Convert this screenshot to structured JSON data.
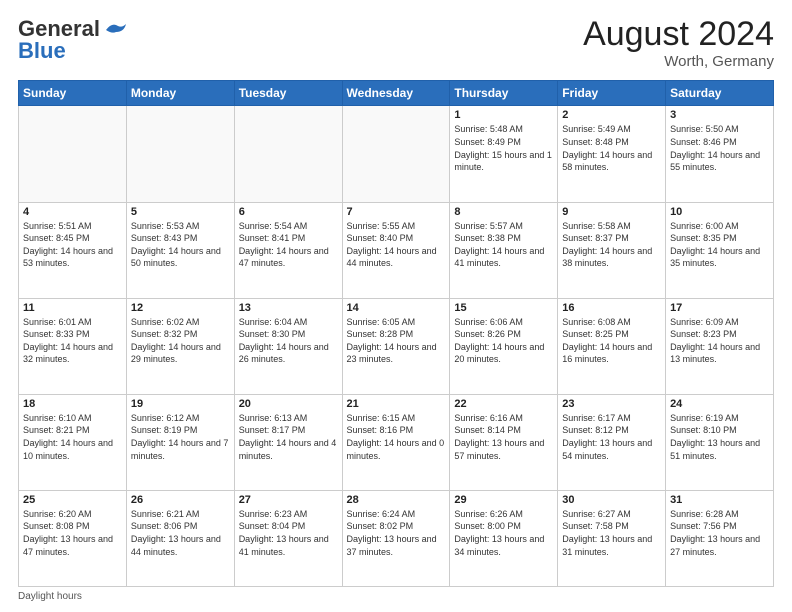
{
  "header": {
    "logo_general": "General",
    "logo_blue": "Blue",
    "month_year": "August 2024",
    "location": "Worth, Germany"
  },
  "days_of_week": [
    "Sunday",
    "Monday",
    "Tuesday",
    "Wednesday",
    "Thursday",
    "Friday",
    "Saturday"
  ],
  "weeks": [
    [
      {
        "day": "",
        "info": ""
      },
      {
        "day": "",
        "info": ""
      },
      {
        "day": "",
        "info": ""
      },
      {
        "day": "",
        "info": ""
      },
      {
        "day": "1",
        "info": "Sunrise: 5:48 AM\nSunset: 8:49 PM\nDaylight: 15 hours\nand 1 minute."
      },
      {
        "day": "2",
        "info": "Sunrise: 5:49 AM\nSunset: 8:48 PM\nDaylight: 14 hours\nand 58 minutes."
      },
      {
        "day": "3",
        "info": "Sunrise: 5:50 AM\nSunset: 8:46 PM\nDaylight: 14 hours\nand 55 minutes."
      }
    ],
    [
      {
        "day": "4",
        "info": "Sunrise: 5:51 AM\nSunset: 8:45 PM\nDaylight: 14 hours\nand 53 minutes."
      },
      {
        "day": "5",
        "info": "Sunrise: 5:53 AM\nSunset: 8:43 PM\nDaylight: 14 hours\nand 50 minutes."
      },
      {
        "day": "6",
        "info": "Sunrise: 5:54 AM\nSunset: 8:41 PM\nDaylight: 14 hours\nand 47 minutes."
      },
      {
        "day": "7",
        "info": "Sunrise: 5:55 AM\nSunset: 8:40 PM\nDaylight: 14 hours\nand 44 minutes."
      },
      {
        "day": "8",
        "info": "Sunrise: 5:57 AM\nSunset: 8:38 PM\nDaylight: 14 hours\nand 41 minutes."
      },
      {
        "day": "9",
        "info": "Sunrise: 5:58 AM\nSunset: 8:37 PM\nDaylight: 14 hours\nand 38 minutes."
      },
      {
        "day": "10",
        "info": "Sunrise: 6:00 AM\nSunset: 8:35 PM\nDaylight: 14 hours\nand 35 minutes."
      }
    ],
    [
      {
        "day": "11",
        "info": "Sunrise: 6:01 AM\nSunset: 8:33 PM\nDaylight: 14 hours\nand 32 minutes."
      },
      {
        "day": "12",
        "info": "Sunrise: 6:02 AM\nSunset: 8:32 PM\nDaylight: 14 hours\nand 29 minutes."
      },
      {
        "day": "13",
        "info": "Sunrise: 6:04 AM\nSunset: 8:30 PM\nDaylight: 14 hours\nand 26 minutes."
      },
      {
        "day": "14",
        "info": "Sunrise: 6:05 AM\nSunset: 8:28 PM\nDaylight: 14 hours\nand 23 minutes."
      },
      {
        "day": "15",
        "info": "Sunrise: 6:06 AM\nSunset: 8:26 PM\nDaylight: 14 hours\nand 20 minutes."
      },
      {
        "day": "16",
        "info": "Sunrise: 6:08 AM\nSunset: 8:25 PM\nDaylight: 14 hours\nand 16 minutes."
      },
      {
        "day": "17",
        "info": "Sunrise: 6:09 AM\nSunset: 8:23 PM\nDaylight: 14 hours\nand 13 minutes."
      }
    ],
    [
      {
        "day": "18",
        "info": "Sunrise: 6:10 AM\nSunset: 8:21 PM\nDaylight: 14 hours\nand 10 minutes."
      },
      {
        "day": "19",
        "info": "Sunrise: 6:12 AM\nSunset: 8:19 PM\nDaylight: 14 hours\nand 7 minutes."
      },
      {
        "day": "20",
        "info": "Sunrise: 6:13 AM\nSunset: 8:17 PM\nDaylight: 14 hours\nand 4 minutes."
      },
      {
        "day": "21",
        "info": "Sunrise: 6:15 AM\nSunset: 8:16 PM\nDaylight: 14 hours\nand 0 minutes."
      },
      {
        "day": "22",
        "info": "Sunrise: 6:16 AM\nSunset: 8:14 PM\nDaylight: 13 hours\nand 57 minutes."
      },
      {
        "day": "23",
        "info": "Sunrise: 6:17 AM\nSunset: 8:12 PM\nDaylight: 13 hours\nand 54 minutes."
      },
      {
        "day": "24",
        "info": "Sunrise: 6:19 AM\nSunset: 8:10 PM\nDaylight: 13 hours\nand 51 minutes."
      }
    ],
    [
      {
        "day": "25",
        "info": "Sunrise: 6:20 AM\nSunset: 8:08 PM\nDaylight: 13 hours\nand 47 minutes."
      },
      {
        "day": "26",
        "info": "Sunrise: 6:21 AM\nSunset: 8:06 PM\nDaylight: 13 hours\nand 44 minutes."
      },
      {
        "day": "27",
        "info": "Sunrise: 6:23 AM\nSunset: 8:04 PM\nDaylight: 13 hours\nand 41 minutes."
      },
      {
        "day": "28",
        "info": "Sunrise: 6:24 AM\nSunset: 8:02 PM\nDaylight: 13 hours\nand 37 minutes."
      },
      {
        "day": "29",
        "info": "Sunrise: 6:26 AM\nSunset: 8:00 PM\nDaylight: 13 hours\nand 34 minutes."
      },
      {
        "day": "30",
        "info": "Sunrise: 6:27 AM\nSunset: 7:58 PM\nDaylight: 13 hours\nand 31 minutes."
      },
      {
        "day": "31",
        "info": "Sunrise: 6:28 AM\nSunset: 7:56 PM\nDaylight: 13 hours\nand 27 minutes."
      }
    ]
  ],
  "footer": "Daylight hours"
}
